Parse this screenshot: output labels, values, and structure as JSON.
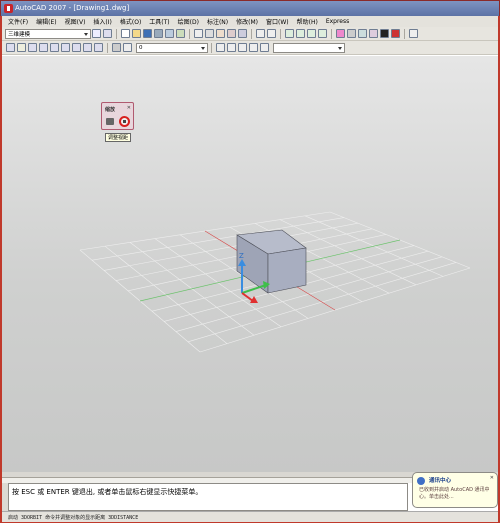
{
  "window": {
    "title": "AutoCAD 2007 - [Drawing1.dwg]"
  },
  "menu": [
    "文件(F)",
    "编辑(E)",
    "视图(V)",
    "插入(I)",
    "格式(O)",
    "工具(T)",
    "绘图(D)",
    "标注(N)",
    "修改(M)",
    "窗口(W)",
    "帮助(H)",
    "Express"
  ],
  "toolbar": {
    "workspace_combo": "三维建模",
    "layer_combo": "0",
    "style_combo": ""
  },
  "viewcube_widget": {
    "title": "缩放",
    "tooltip": "调整视距"
  },
  "ucs_axis_label": "Z",
  "command_window": {
    "prompt": "按 ESC 或 ENTER 键退出, 或者单击鼠标右键显示快捷菜单。"
  },
  "status_bar": {
    "text": "启动 3DORBIT 命令并调整对象的显示距离   3DDISTANCE"
  },
  "balloon": {
    "title": "通讯中心",
    "body": "已收到并启动 AutoCAD 通讯中心。单击此处..."
  },
  "colors": {
    "titlebar": "#6a80b5",
    "frame_border": "#c0392b",
    "grid_red_axis": "#d24a4a",
    "grid_green_axis": "#6cc06c",
    "box_face": "#a8b0c2"
  }
}
